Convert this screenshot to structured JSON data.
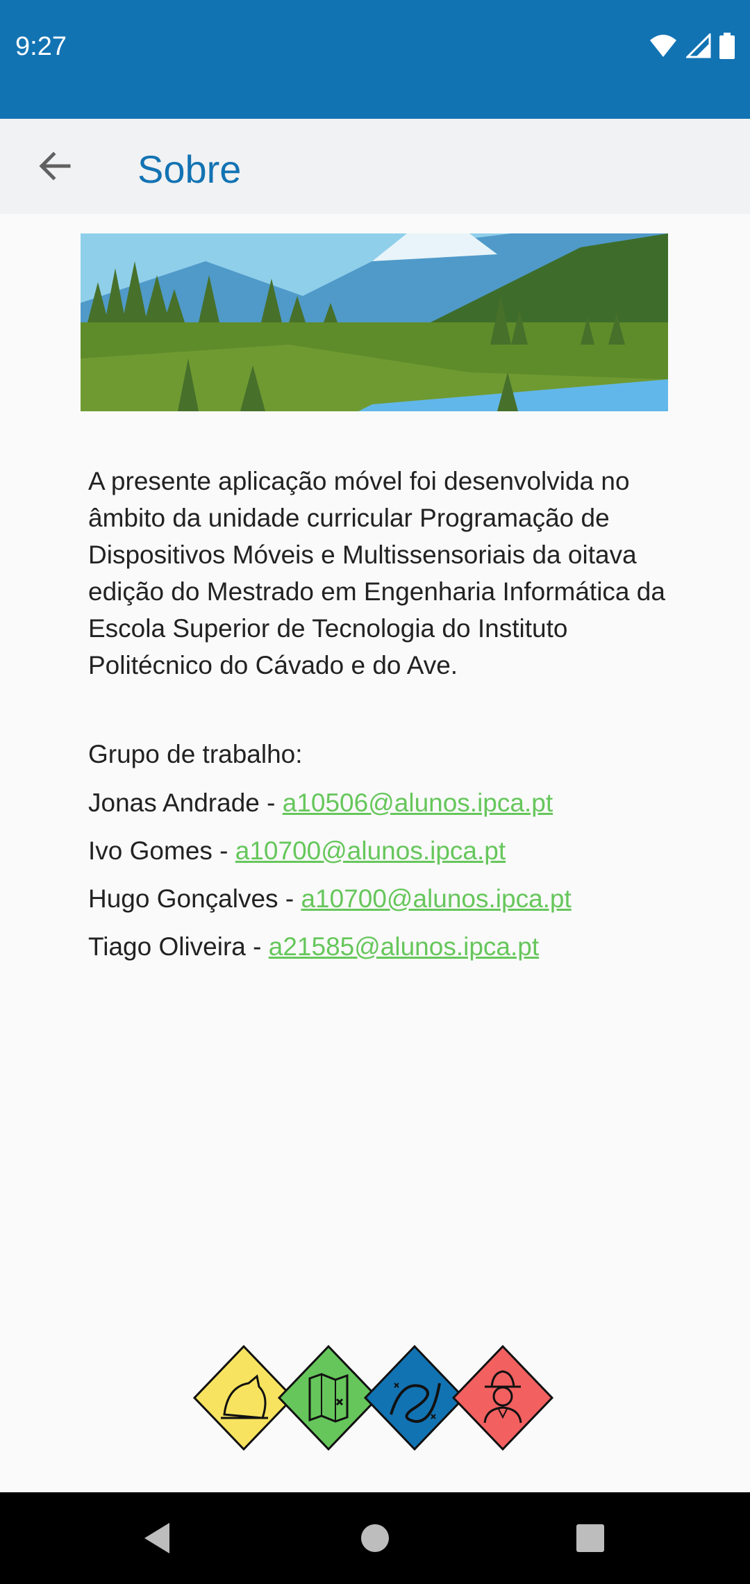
{
  "status_bar": {
    "time": "9:27",
    "icons": [
      "wifi-icon",
      "signal-icon",
      "battery-icon"
    ],
    "background": "#1273b3"
  },
  "app_bar": {
    "title": "Sobre",
    "back_icon": "arrow-left-icon",
    "title_color": "#1273b3"
  },
  "about": {
    "text": "A presente aplicação móvel foi desenvolvida no âmbito da unidade curricular Programação de Dispositivos Móveis e Multissensoriais da oitava edição do Mestrado em Engenharia Informática da Escola Superior de Tecnologia do Instituto Politécnico do Cávado e do Ave."
  },
  "group": {
    "title": "Grupo de trabalho:",
    "members": [
      {
        "name": "Jonas Andrade - ",
        "email": "a10506@alunos.ipca.pt"
      },
      {
        "name": "Ivo Gomes - ",
        "email": "a10700@alunos.ipca.pt"
      },
      {
        "name": "Hugo Gonçalves - ",
        "email": "a10700@alunos.ipca.pt"
      },
      {
        "name": "Tiago Oliveira - ",
        "email": "a21585@alunos.ipca.pt"
      }
    ],
    "link_color": "#66c65b"
  },
  "badges": [
    {
      "icon": "wolf-howling-icon",
      "color": "#f7e35f"
    },
    {
      "icon": "treasure-map-icon",
      "color": "#66c65b"
    },
    {
      "icon": "knot-icon",
      "color": "#1273b3"
    },
    {
      "icon": "scout-person-icon",
      "color": "#f26060"
    }
  ],
  "nav_bar": {
    "buttons": [
      "back-triangle-icon",
      "home-circle-icon",
      "recents-square-icon"
    ]
  }
}
